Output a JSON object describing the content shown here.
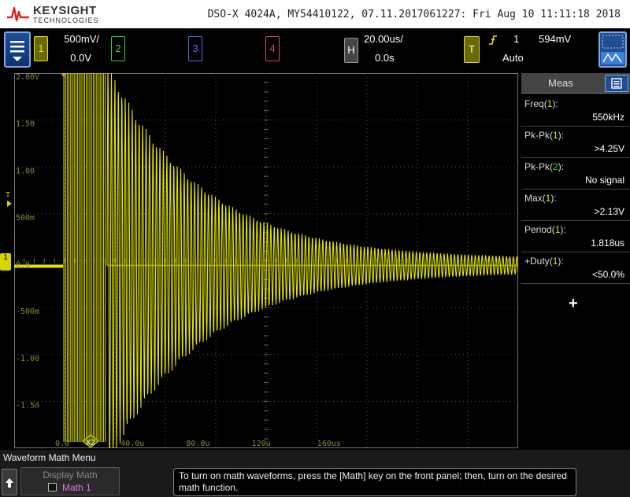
{
  "brand": {
    "name": "KEYSIGHT",
    "sub": "TECHNOLOGIES"
  },
  "title": "DSO-X 4024A, MY54410122, 07.11.2017061227: Fri Aug 10 11:11:18 2018",
  "channels": [
    {
      "num": "1",
      "scale": "500mV/",
      "offset": "0.0V",
      "color": "#e6e600"
    },
    {
      "num": "2",
      "color": "#35d535"
    },
    {
      "num": "3",
      "color": "#4a6cf0"
    },
    {
      "num": "4",
      "color": "#e0408a"
    }
  ],
  "horizontal": {
    "label": "H",
    "scale": "20.00us/",
    "delay": "0.0s"
  },
  "trigger": {
    "label": "T",
    "source": "1",
    "level": "594mV",
    "mode": "Auto",
    "slope_icon": "rising-edge-icon"
  },
  "icons": {
    "menu": "menu-icon",
    "zoom": "zoom-icon",
    "meas_list": "list-icon",
    "back": "up-arrow-icon"
  },
  "plot": {
    "y_labels": [
      "2.00V",
      "1.50",
      "1.00",
      "500m",
      "0.0",
      "-500m",
      "-1.00",
      "-1.50"
    ],
    "x_labels": [
      "0.0",
      "40.0u",
      "80.0u",
      "120u",
      "160us"
    ],
    "cursor_label": "X2",
    "trace_color": "#e6e600",
    "ground_marker": "1",
    "trig_marker": "T"
  },
  "meas": {
    "title": "Meas",
    "items": [
      {
        "name": "Freq",
        "ch": "1",
        "value": "550kHz"
      },
      {
        "name": "Pk-Pk",
        "ch": "1",
        "value": ">4.25V"
      },
      {
        "name": "Pk-Pk",
        "ch": "2",
        "value": "No signal"
      },
      {
        "name": "Max",
        "ch": "1",
        "value": ">2.13V"
      },
      {
        "name": "Period",
        "ch": "1",
        "value": "1.818us"
      },
      {
        "name": "+Duty",
        "ch": "1",
        "value": "<50.0%"
      }
    ],
    "add": "+"
  },
  "softmenu": {
    "title": "Waveform Math Menu",
    "display_math": "Display Math",
    "math1": "Math 1",
    "help": "To turn on math waveforms, press the [Math] key on the front panel; then, turn on the desired math function."
  }
}
